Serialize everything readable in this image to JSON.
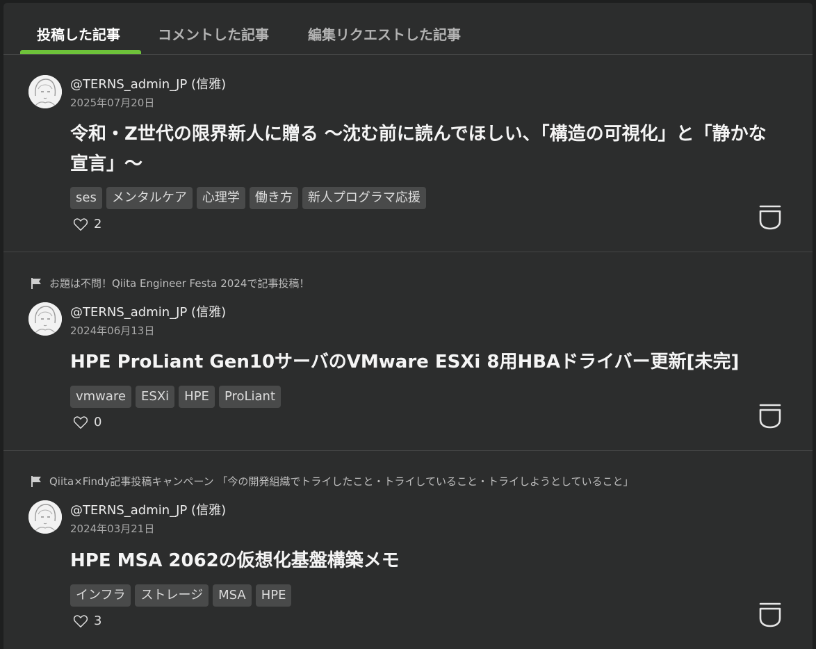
{
  "tabs": [
    {
      "label": "投稿した記事",
      "active": true
    },
    {
      "label": "コメントした記事",
      "active": false
    },
    {
      "label": "編集リクエストした記事",
      "active": false
    }
  ],
  "articles": [
    {
      "event": "",
      "author": "@TERNS_admin_JP (信雅)",
      "date": "2025年07月20日",
      "title": "令和・Z世代の限界新人に贈る 〜沈む前に読んでほしい、「構造の可視化」と「静かな宣言」〜",
      "tags": [
        "ses",
        "メンタルケア",
        "心理学",
        "働き方",
        "新人プログラマ応援"
      ],
      "likes": "2"
    },
    {
      "event": "お題は不問！Qiita Engineer Festa 2024で記事投稿！",
      "author": "@TERNS_admin_JP (信雅)",
      "date": "2024年06月13日",
      "title": "HPE ProLiant Gen10サーバのVMware ESXi 8用HBAドライバー更新[未完]",
      "tags": [
        "vmware",
        "ESXi",
        "HPE",
        "ProLiant"
      ],
      "likes": "0"
    },
    {
      "event": "Qiita×Findy記事投稿キャンペーン 「今の開発組織でトライしたこと・トライしていること・トライしようとしていること」",
      "author": "@TERNS_admin_JP (信雅)",
      "date": "2024年03月21日",
      "title": "HPE MSA 2062の仮想化基盤構築メモ",
      "tags": [
        "インフラ",
        "ストレージ",
        "MSA",
        "HPE"
      ],
      "likes": "3"
    }
  ],
  "colors": {
    "accent": "#6ec23a",
    "panel": "#2c2d2d",
    "tag_bg": "#494a4a"
  },
  "icons": {
    "flag": "flag-icon",
    "heart": "heart-icon",
    "stock": "stock-icon",
    "avatar": "avatar"
  }
}
